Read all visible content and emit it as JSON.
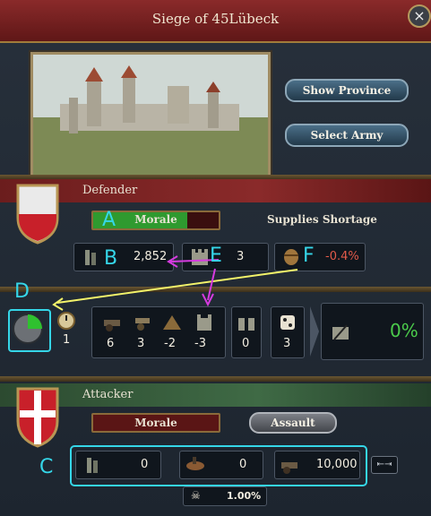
{
  "window": {
    "title": "Siege of 45Lübeck",
    "close_label": "×"
  },
  "buttons": {
    "show_province": "Show Province",
    "select_army": "Select Army",
    "assault": "Assault"
  },
  "defender": {
    "heading": "Defender",
    "morale_label": "Morale",
    "morale_fraction": 0.75,
    "supplies": "Supplies Shortage",
    "troops": "2,852",
    "forts": "3",
    "supply_change": "-0.4%"
  },
  "siege": {
    "progress_days": "1",
    "modifiers": [
      "6",
      "3",
      "-2",
      "-3"
    ],
    "breach": "0",
    "dice": "3",
    "chance": "0%"
  },
  "attacker": {
    "heading": "Attacker",
    "morale_label": "Morale",
    "infantry": "0",
    "cavalry": "0",
    "artillery": "10,000",
    "bottom_stat": "1.00%"
  },
  "annotations": {
    "a": "A",
    "b": "B",
    "c": "C",
    "d": "D",
    "e": "E",
    "f": "F"
  },
  "colors": {
    "morale_green": "#2f9a2f",
    "accent_cyan": "#35d6e8",
    "arrow_magenta": "#d63be0",
    "arrow_yellow": "#f3f36a"
  }
}
